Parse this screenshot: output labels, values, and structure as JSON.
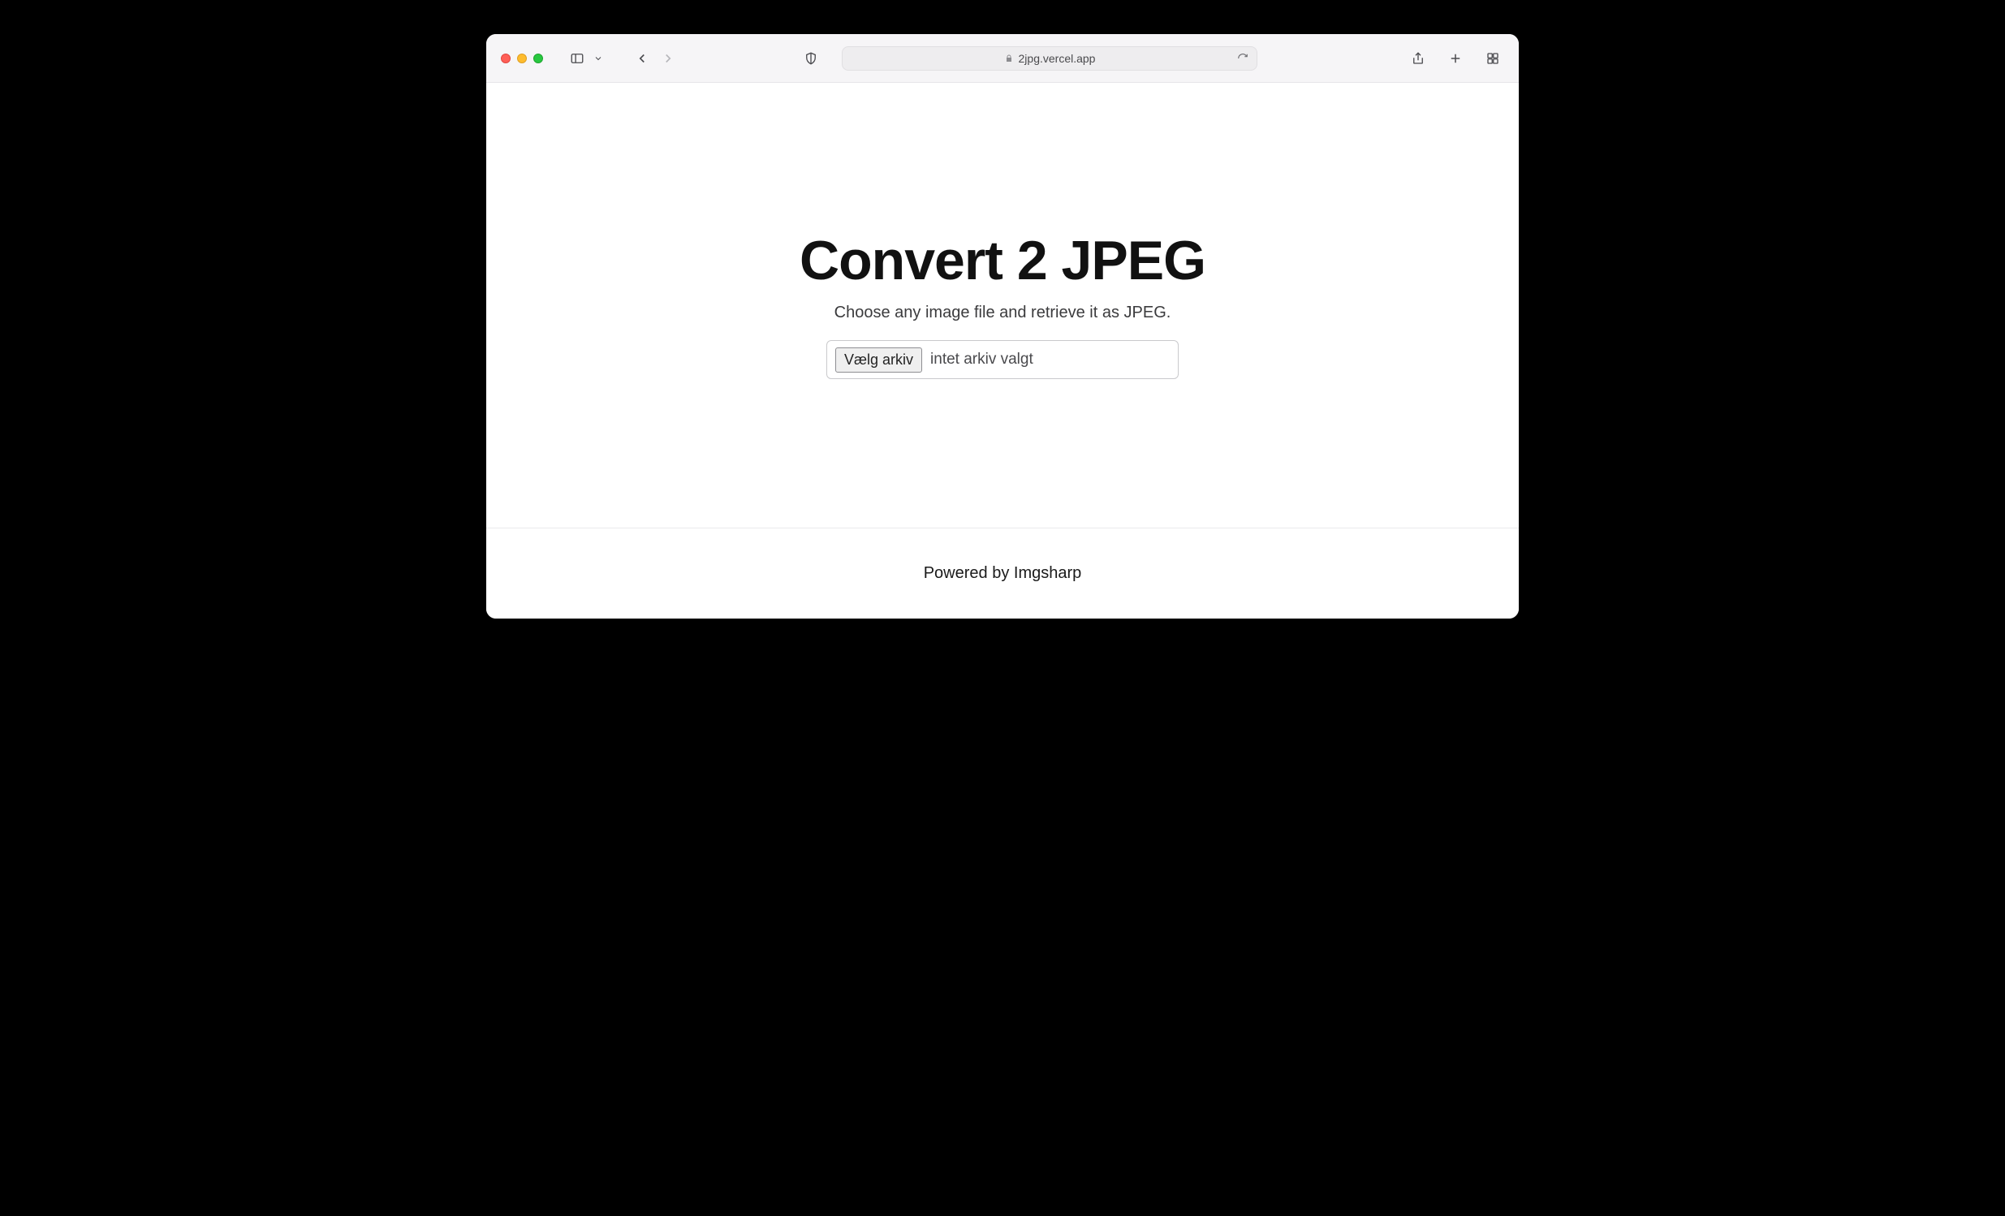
{
  "browser": {
    "url": "2jpg.vercel.app"
  },
  "page": {
    "title": "Convert 2 JPEG",
    "subtitle": "Choose any image file and retrieve it as JPEG.",
    "file_input": {
      "button_label": "Vælg arkiv",
      "status_text": "intet arkiv valgt"
    },
    "footer": "Powered by Imgsharp"
  }
}
